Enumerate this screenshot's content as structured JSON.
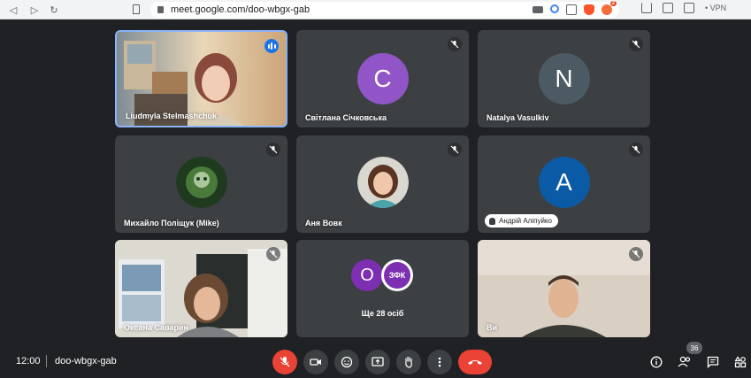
{
  "browser": {
    "url": "meet.google.com/doo-wbgx-gab",
    "vpn_label": "VPN",
    "brave_badge": "2"
  },
  "tiles": [
    {
      "name": "Liudmyla Stelmashchuk"
    },
    {
      "name": "Світлана Січковська",
      "initial": "C",
      "avatar_color": "#9155c7"
    },
    {
      "name": "Natalya Vasulkiv",
      "initial": "N",
      "avatar_color": "#4b5a63"
    },
    {
      "name": "Михайло Поліщук (Mike)"
    },
    {
      "name": "Аня Вовк"
    },
    {
      "name": "Андрій Аліпуйко",
      "initial": "A",
      "avatar_color": "#0b5aa5"
    },
    {
      "name": "Оксана Саварин"
    },
    {
      "more_label": "Ще 28 осіб",
      "initial": "O",
      "avatar_color": "#7c2fb0",
      "logo_text": "ЗФК"
    },
    {
      "name": "Ви"
    }
  ],
  "bottom": {
    "time": "12:00",
    "meeting_code": "doo-wbgx-gab",
    "participant_count": "36"
  },
  "colors": {
    "background": "#202124",
    "tile": "#3c4043",
    "accent_blue": "#1a73e8",
    "danger_red": "#ea4335"
  }
}
